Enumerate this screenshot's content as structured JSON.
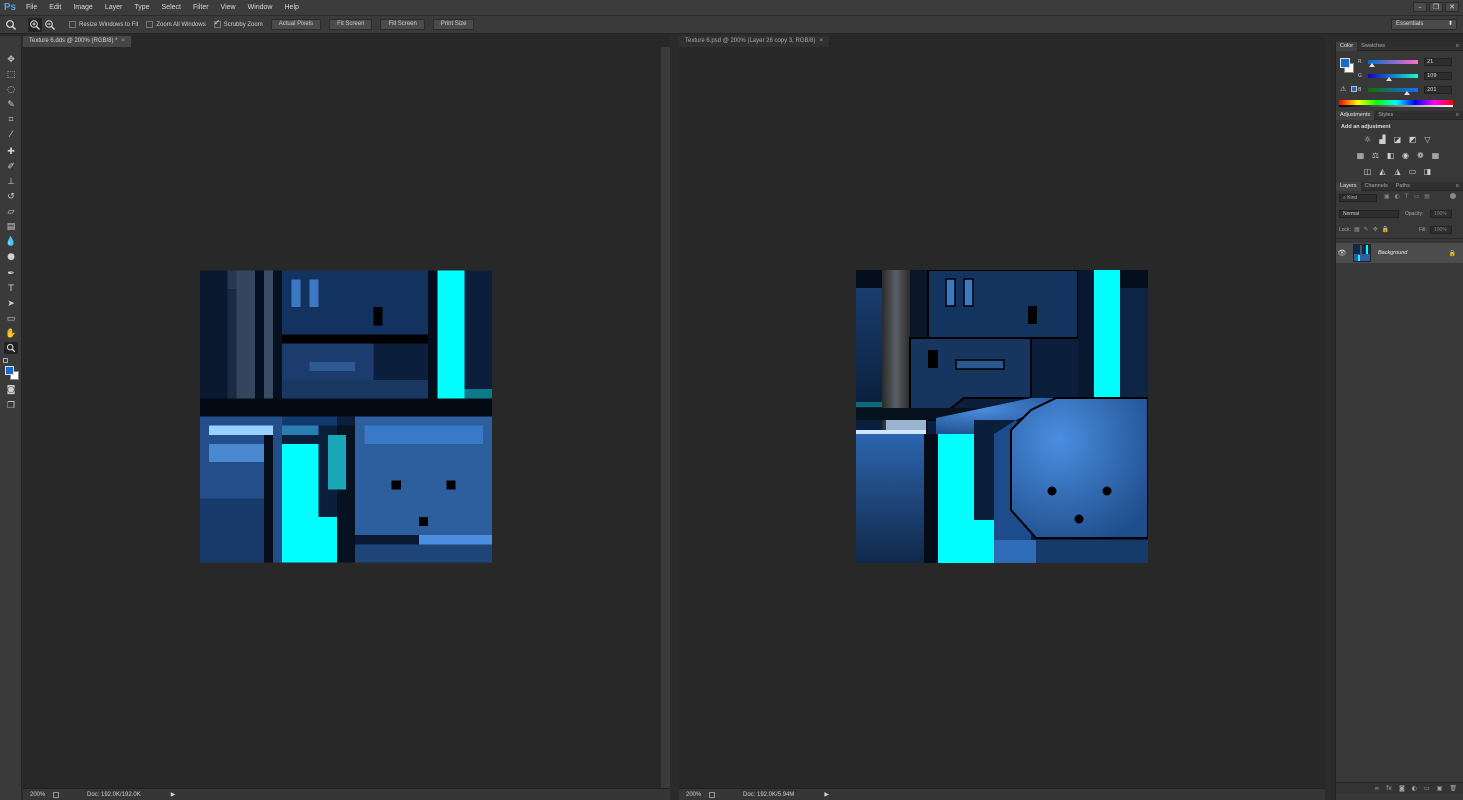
{
  "app": {
    "logo": "Ps",
    "menu": [
      "File",
      "Edit",
      "Image",
      "Layer",
      "Type",
      "Select",
      "Filter",
      "View",
      "Window",
      "Help"
    ],
    "window_controls": [
      "–",
      "❐",
      "✕"
    ]
  },
  "options": {
    "resize_windows": "Resize Windows to Fit",
    "zoom_all": "Zoom All Windows",
    "scrubby_zoom": "Scrubby Zoom",
    "actual_pixels": "Actual Pixels",
    "fit_screen": "Fit Screen",
    "fill_screen": "Fill Screen",
    "print_size": "Print Size",
    "workspace": "Essentials"
  },
  "documents": [
    {
      "tab": "Texture 6.dds @ 200% (RGB/8) *",
      "zoom": "200%",
      "doc_info": "Doc: 192.0K/192.0K"
    },
    {
      "tab": "Texture 6.psd @ 200% (Layer 26 copy 3, RGB/8)",
      "zoom": "200%",
      "doc_info": "Doc: 192.0K/5.94M"
    }
  ],
  "color_panel": {
    "tabs": [
      "Color",
      "Swatches"
    ],
    "r_label": "R",
    "g_label": "G",
    "b_label": "B",
    "r": "21",
    "g": "109",
    "b": "201",
    "r_level": 0.082,
    "g_level": 0.427,
    "b_level": 0.788,
    "foreground": "#156dc9"
  },
  "adjustments_panel": {
    "tabs": [
      "Adjustments",
      "Styles"
    ],
    "heading": "Add an adjustment"
  },
  "layers_panel": {
    "tabs": [
      "Layers",
      "Channels",
      "Paths"
    ],
    "kind": "Kind",
    "blend_mode": "Normal",
    "opacity_label": "Opacity:",
    "opacity_value": "100%",
    "lock_label": "Lock:",
    "fill_label": "Fill:",
    "fill_value": "100%",
    "layer_name": "Background"
  },
  "colors": {
    "cyan": "#00ffff",
    "dark_blue": "#0d2a4e",
    "mid_blue": "#2f5f9e"
  }
}
